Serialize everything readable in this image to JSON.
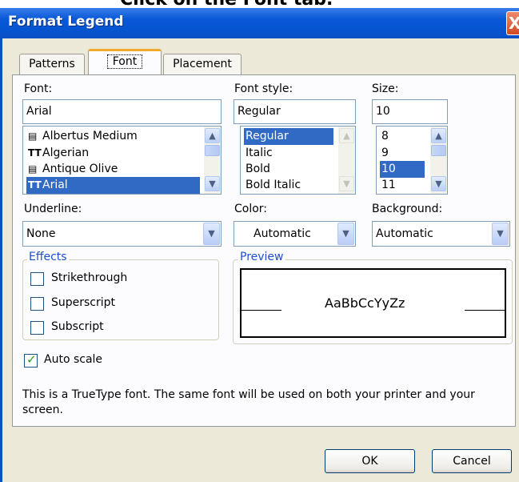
{
  "caption": "Click on the Font tab.",
  "window": {
    "title": "Format Legend",
    "close_glyph": "X"
  },
  "tabs": [
    {
      "label": "Patterns",
      "active": false
    },
    {
      "label": "Font",
      "active": true
    },
    {
      "label": "Placement",
      "active": false
    }
  ],
  "font": {
    "label": "Font:",
    "value": "Arial",
    "items": [
      {
        "label": "Albertus Medium",
        "icon": "printer-font-icon",
        "selected": false
      },
      {
        "label": "Algerian",
        "icon": "truetype-icon",
        "selected": false
      },
      {
        "label": "Antique Olive",
        "icon": "printer-font-icon",
        "selected": false
      },
      {
        "label": "Arial",
        "icon": "truetype-icon",
        "selected": true
      }
    ]
  },
  "font_style": {
    "label": "Font style:",
    "value": "Regular",
    "items": [
      {
        "label": "Regular",
        "selected": true
      },
      {
        "label": "Italic",
        "selected": false
      },
      {
        "label": "Bold",
        "selected": false
      },
      {
        "label": "Bold Italic",
        "selected": false
      }
    ]
  },
  "size": {
    "label": "Size:",
    "value": "10",
    "items": [
      {
        "label": "8",
        "selected": false
      },
      {
        "label": "9",
        "selected": false
      },
      {
        "label": "10",
        "selected": true
      },
      {
        "label": "11",
        "selected": false
      }
    ]
  },
  "underline": {
    "label": "Underline:",
    "value": "None"
  },
  "color": {
    "label": "Color:",
    "value": "Automatic"
  },
  "background": {
    "label": "Background:",
    "value": "Automatic"
  },
  "effects": {
    "title": "Effects",
    "items": [
      {
        "label": "Strikethrough",
        "checked": false
      },
      {
        "label": "Superscript",
        "checked": false
      },
      {
        "label": "Subscript",
        "checked": false
      }
    ]
  },
  "preview": {
    "title": "Preview",
    "sample": "AaBbCcYyZz"
  },
  "auto_scale": {
    "label": "Auto scale",
    "checked": true
  },
  "info_text": "This is a TrueType font.  The same font will be used on both your printer and your screen.",
  "buttons": {
    "ok": "OK",
    "cancel": "Cancel"
  },
  "colors": {
    "titlebar": "#0554d0",
    "dialog_bg": "#ece9d8",
    "selection": "#316ac5",
    "tab_accent": "#f3a92a"
  }
}
